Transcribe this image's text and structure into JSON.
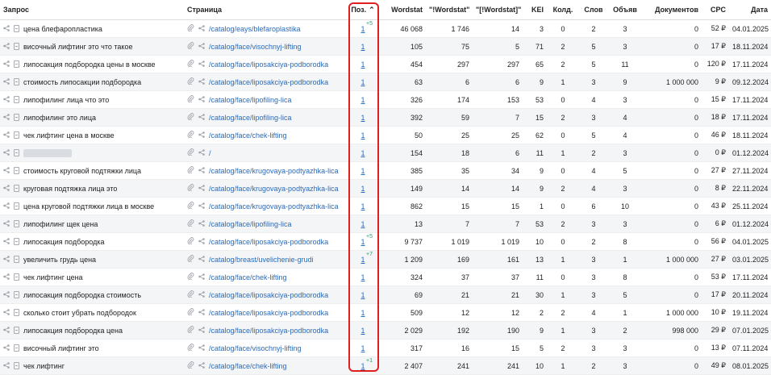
{
  "columns": {
    "query": "Запрос",
    "page": "Страница",
    "pos": "Поз.",
    "wordstat": "Wordstat",
    "ws_quote": "\"!Wordstat\"",
    "ws_bracket": "\"[!Wordstat]\"",
    "kei": "KEI",
    "kold": "Колд.",
    "words": "Слов",
    "ads": "Объяв",
    "docs": "Документов",
    "cpc": "CPC",
    "date": "Дата"
  },
  "rows": [
    {
      "query": "цена блефаропластика",
      "url": "/catalog/eays/blefaroplastika",
      "pos": "1",
      "delta": "+5",
      "ws": "46 068",
      "wsq": "1 746",
      "wsb": "14",
      "kei": "3",
      "kold": "0",
      "words": "2",
      "ads": "3",
      "docs": "0",
      "cpc": "52 ₽",
      "date": "04.01.2025"
    },
    {
      "query": "височный лифтинг это что такое",
      "url": "/catalog/face/visochnyj-lifting",
      "pos": "1",
      "delta": "",
      "ws": "105",
      "wsq": "75",
      "wsb": "5",
      "kei": "71",
      "kold": "2",
      "words": "5",
      "ads": "3",
      "docs": "0",
      "cpc": "17 ₽",
      "date": "18.11.2024"
    },
    {
      "query": "липосакция подбородка цены в москве",
      "url": "/catalog/face/liposakciya-podborodka",
      "pos": "1",
      "delta": "",
      "ws": "454",
      "wsq": "297",
      "wsb": "297",
      "kei": "65",
      "words": "5",
      "kold": "2",
      "ads": "11",
      "docs": "0",
      "cpc": "120 ₽",
      "date": "17.11.2024"
    },
    {
      "query": "стоимость липосакции подбородка",
      "url": "/catalog/face/liposakciya-podborodka",
      "pos": "1",
      "delta": "",
      "ws": "63",
      "wsq": "6",
      "wsb": "6",
      "kei": "9",
      "kold": "1",
      "words": "3",
      "ads": "9",
      "docs": "1 000 000",
      "cpc": "9 ₽",
      "date": "09.12.2024"
    },
    {
      "query": "липофилинг лица что это",
      "url": "/catalog/face/lipofiling-lica",
      "pos": "1",
      "delta": "",
      "ws": "326",
      "wsq": "174",
      "wsb": "153",
      "kei": "53",
      "kold": "0",
      "words": "4",
      "ads": "3",
      "docs": "0",
      "cpc": "15 ₽",
      "date": "17.11.2024"
    },
    {
      "query": "липофилинг это лица",
      "url": "/catalog/face/lipofiling-lica",
      "pos": "1",
      "delta": "",
      "ws": "392",
      "wsq": "59",
      "wsb": "7",
      "kei": "15",
      "kold": "2",
      "words": "3",
      "ads": "4",
      "docs": "0",
      "cpc": "18 ₽",
      "date": "17.11.2024"
    },
    {
      "query": "чек лифтинг цена в москве",
      "url": "/catalog/face/chek-lifting",
      "pos": "1",
      "delta": "",
      "ws": "50",
      "wsq": "25",
      "wsb": "25",
      "kei": "62",
      "kold": "0",
      "words": "5",
      "ads": "4",
      "docs": "0",
      "cpc": "46 ₽",
      "date": "18.11.2024"
    },
    {
      "query": "",
      "url": "/",
      "pos": "1",
      "delta": "",
      "ws": "154",
      "wsq": "18",
      "wsb": "6",
      "kei": "11",
      "kold": "1",
      "words": "2",
      "ads": "3",
      "docs": "0",
      "cpc": "0 ₽",
      "date": "01.12.2024",
      "hidden": true
    },
    {
      "query": "стоимость круговой подтяжки лица",
      "url": "/catalog/face/krugovaya-podtyazhka-lica",
      "pos": "1",
      "delta": "",
      "ws": "385",
      "wsq": "35",
      "wsb": "34",
      "kei": "9",
      "kold": "0",
      "words": "4",
      "ads": "5",
      "docs": "0",
      "cpc": "27 ₽",
      "date": "27.11.2024"
    },
    {
      "query": "круговая подтяжка лица это",
      "url": "/catalog/face/krugovaya-podtyazhka-lica",
      "pos": "1",
      "delta": "",
      "ws": "149",
      "wsq": "14",
      "wsb": "14",
      "kei": "9",
      "kold": "2",
      "words": "4",
      "ads": "3",
      "docs": "0",
      "cpc": "8 ₽",
      "date": "22.11.2024"
    },
    {
      "query": "цена круговой подтяжки лица в москве",
      "url": "/catalog/face/krugovaya-podtyazhka-lica",
      "pos": "1",
      "delta": "",
      "ws": "862",
      "wsq": "15",
      "wsb": "15",
      "kei": "1",
      "kold": "0",
      "words": "6",
      "ads": "10",
      "docs": "0",
      "cpc": "43 ₽",
      "date": "25.11.2024"
    },
    {
      "query": "липофилинг щек цена",
      "url": "/catalog/face/lipofiling-lica",
      "pos": "1",
      "delta": "",
      "ws": "13",
      "wsq": "7",
      "wsb": "7",
      "kei": "53",
      "kold": "2",
      "words": "3",
      "ads": "3",
      "docs": "0",
      "cpc": "6 ₽",
      "date": "01.12.2024"
    },
    {
      "query": "липосакция подбородка",
      "url": "/catalog/face/liposakciya-podborodka",
      "pos": "1",
      "delta": "+5",
      "ws": "9 737",
      "wsq": "1 019",
      "wsb": "1 019",
      "kei": "10",
      "kold": "0",
      "words": "2",
      "ads": "8",
      "docs": "0",
      "cpc": "56 ₽",
      "date": "04.01.2025"
    },
    {
      "query": "увеличить грудь цена",
      "url": "/catalog/breast/uvelichenie-grudi",
      "pos": "1",
      "delta": "+7",
      "ws": "1 209",
      "wsq": "169",
      "wsb": "161",
      "kei": "13",
      "kold": "1",
      "words": "3",
      "ads": "1",
      "docs": "1 000 000",
      "cpc": "27 ₽",
      "date": "03.01.2025"
    },
    {
      "query": "чек лифтинг цена",
      "url": "/catalog/face/chek-lifting",
      "pos": "1",
      "delta": "",
      "ws": "324",
      "wsq": "37",
      "wsb": "37",
      "kei": "11",
      "kold": "0",
      "words": "3",
      "ads": "8",
      "docs": "0",
      "cpc": "53 ₽",
      "date": "17.11.2024"
    },
    {
      "query": "липосакция подбородка стоимость",
      "url": "/catalog/face/liposakciya-podborodka",
      "pos": "1",
      "delta": "",
      "ws": "69",
      "wsq": "21",
      "wsb": "21",
      "kei": "30",
      "kold": "1",
      "words": "3",
      "ads": "5",
      "docs": "0",
      "cpc": "17 ₽",
      "date": "20.11.2024"
    },
    {
      "query": "сколько стоит убрать подбородок",
      "url": "/catalog/face/liposakciya-podborodka",
      "pos": "1",
      "delta": "",
      "ws": "509",
      "wsq": "12",
      "wsb": "12",
      "kei": "2",
      "kold": "2",
      "words": "4",
      "ads": "1",
      "docs": "1 000 000",
      "cpc": "10 ₽",
      "date": "19.11.2024"
    },
    {
      "query": "липосакция подбородка цена",
      "url": "/catalog/face/liposakciya-podborodka",
      "pos": "1",
      "delta": "",
      "ws": "2 029",
      "wsq": "192",
      "wsb": "190",
      "kei": "9",
      "kold": "1",
      "words": "3",
      "ads": "2",
      "docs": "998 000",
      "cpc": "29 ₽",
      "date": "07.01.2025"
    },
    {
      "query": "височный лифтинг это",
      "url": "/catalog/face/visochnyj-lifting",
      "pos": "1",
      "delta": "",
      "ws": "317",
      "wsq": "16",
      "wsb": "15",
      "kei": "5",
      "kold": "2",
      "words": "3",
      "ads": "3",
      "docs": "0",
      "cpc": "13 ₽",
      "date": "07.11.2024"
    },
    {
      "query": "чек лифтинг",
      "url": "/catalog/face/chek-lifting",
      "pos": "1",
      "delta": "+1",
      "ws": "2 407",
      "wsq": "241",
      "wsb": "241",
      "kei": "10",
      "kold": "1",
      "words": "2",
      "ads": "3",
      "docs": "0",
      "cpc": "49 ₽",
      "date": "08.01.2025"
    }
  ]
}
